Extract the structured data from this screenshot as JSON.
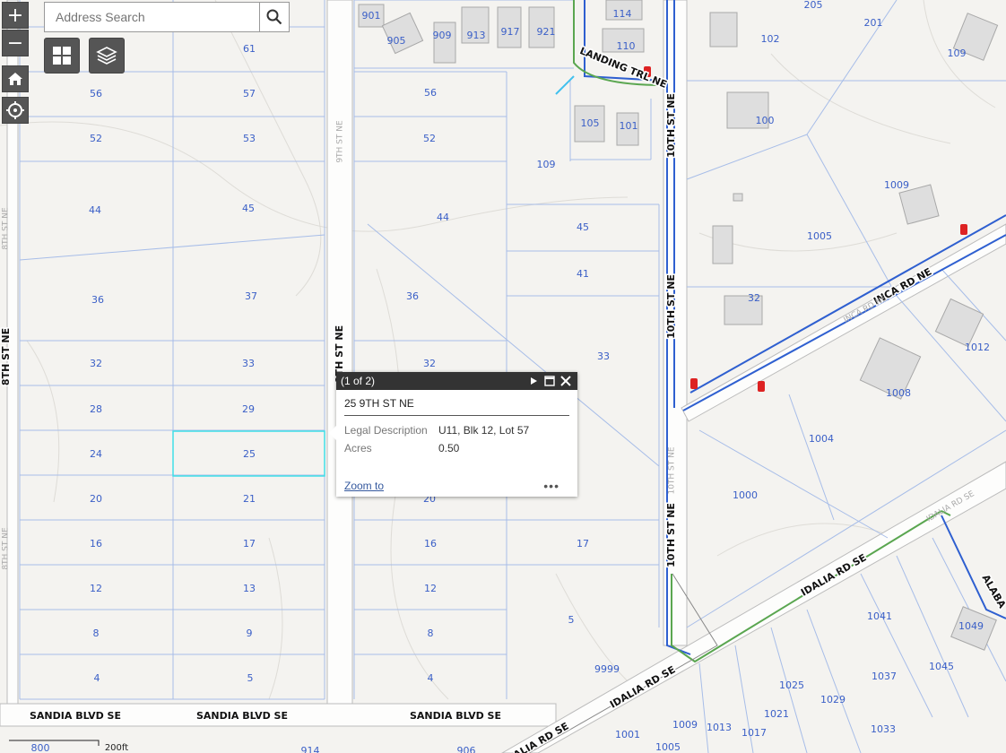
{
  "search": {
    "placeholder": "Address Search"
  },
  "controls": {
    "zoom_in": "+",
    "zoom_out": "−",
    "basemap_icon": "grid-icon",
    "layers_icon": "layers-icon",
    "home_icon": "home-icon",
    "locate_icon": "locate-icon"
  },
  "popup": {
    "counter": "(1 of 2)",
    "title": "25 9TH ST NE",
    "fields": [
      {
        "label": "Legal Description",
        "value": "U11, Blk 12, Lot 57"
      },
      {
        "label": "Acres",
        "value": "0.50"
      }
    ],
    "zoom_to": "Zoom to",
    "more": "•••"
  },
  "map": {
    "roads": {
      "ninth_st_upper": "9TH ST NE",
      "ninth_st_main": "9TH ST NE",
      "eighth_st": "8TH ST NE",
      "eighth_st_upper": "8TH ST NE",
      "eighth_st_lower": "8TH ST NE",
      "tenth_st_upper": "10TH ST NE",
      "tenth_st_mid": "10TH ST NE",
      "tenth_st_lower": "10TH ST NE",
      "tenth_st_faint": "10TH ST NE",
      "landing_trl": "LANDING TRL NE",
      "inca_rd": "INCA RD NE",
      "inca_rd_faint": "INCA RD NE",
      "idalia_rd_1": "IDALIA RD SE",
      "idalia_rd_2": "IDALIA RD SE",
      "idalia_rd_3": "IDALIA RD SE",
      "idalia_faint": "IDALIA RD SE",
      "sandia_1": "SANDIA BLVD SE",
      "sandia_2": "SANDIA BLVD SE",
      "sandia_3": "SANDIA BLVD SE",
      "alabama": "ALABA",
      "scale": "200ft"
    },
    "parcels": [
      "61",
      "56",
      "57",
      "52",
      "53",
      "44",
      "45",
      "36",
      "37",
      "32",
      "33",
      "28",
      "29",
      "24",
      "25",
      "20",
      "21",
      "16",
      "17",
      "12",
      "13",
      "8",
      "9",
      "4",
      "5",
      "56",
      "52",
      "44",
      "36",
      "32",
      "20",
      "16",
      "12",
      "8",
      "4",
      "109",
      "45",
      "41",
      "33",
      "17",
      "5",
      "9999",
      "114",
      "110",
      "105",
      "101",
      "901",
      "905",
      "909",
      "913",
      "917",
      "921",
      "205",
      "201",
      "102",
      "109",
      "100",
      "1009",
      "1005",
      "32",
      "1012",
      "1008",
      "1004",
      "1000",
      "1041",
      "1049",
      "1037",
      "1045",
      "1025",
      "1029",
      "1021",
      "1033",
      "1009",
      "1013",
      "1017",
      "1001",
      "1005",
      "800",
      "914",
      "906"
    ]
  }
}
